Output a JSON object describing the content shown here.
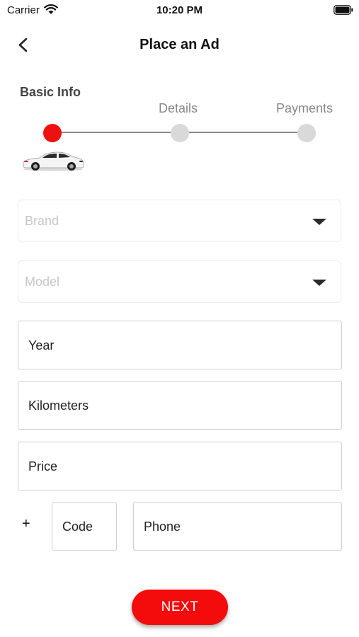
{
  "status_bar": {
    "carrier": "Carrier",
    "time": "10:20 PM",
    "wifi_icon": "wifi-icon",
    "battery_icon": "battery-icon"
  },
  "nav": {
    "title": "Place an Ad",
    "back_icon": "chevron-left-icon"
  },
  "stepper": {
    "steps": [
      {
        "label": "Basic Info",
        "active": true
      },
      {
        "label": "Details",
        "active": false
      },
      {
        "label": "Payments",
        "active": false
      }
    ],
    "active_color": "#ee1111",
    "inactive_color": "#d9d9d9",
    "progress_icon": "car-icon"
  },
  "form": {
    "brand": {
      "placeholder": "Brand",
      "icon": "caret-down-icon"
    },
    "model": {
      "placeholder": "Model",
      "icon": "caret-down-icon"
    },
    "year": {
      "placeholder": "Year",
      "value": ""
    },
    "kilometers": {
      "placeholder": "Kilometers",
      "value": ""
    },
    "price": {
      "placeholder": "Price",
      "value": ""
    },
    "phone_prefix": "+",
    "code": {
      "placeholder": "Code",
      "value": ""
    },
    "phone": {
      "placeholder": "Phone",
      "value": ""
    }
  },
  "actions": {
    "next_label": "NEXT",
    "accent_color": "#f40b0b"
  }
}
